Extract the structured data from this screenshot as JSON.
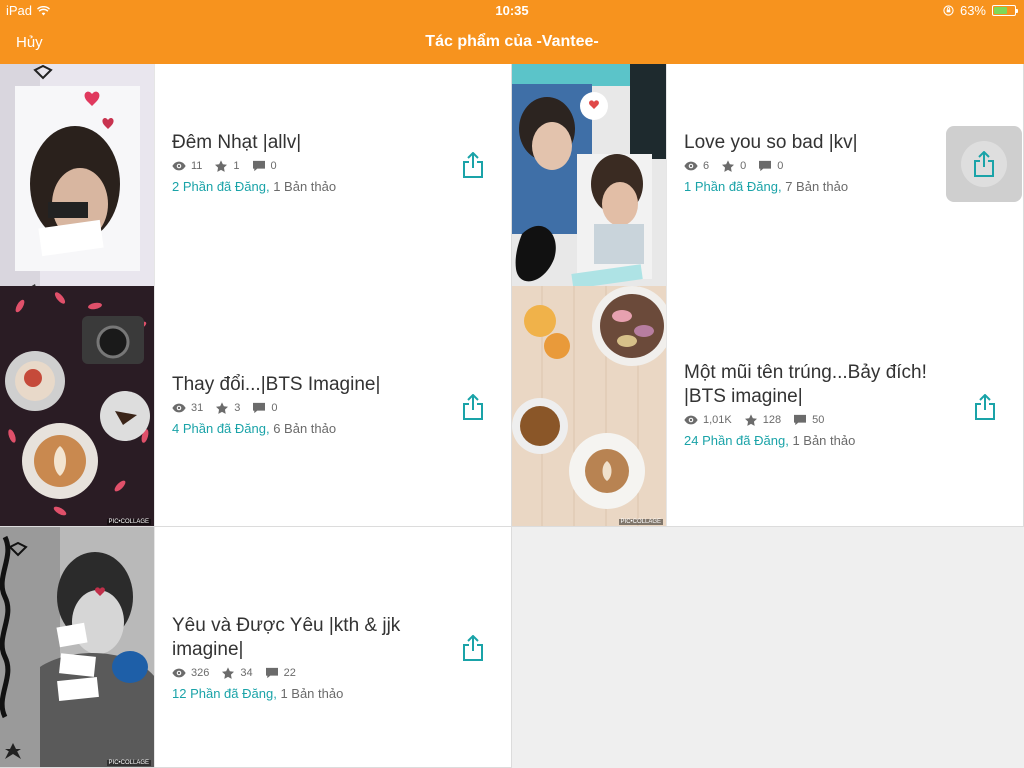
{
  "status": {
    "device": "iPad",
    "time": "10:35",
    "battery": "63%",
    "battery_level": 0.63
  },
  "nav": {
    "cancel": "Hủy",
    "title": "Tác phẩm của -Vantee-"
  },
  "colors": {
    "accent": "#f7931e",
    "link": "#1aa3a8",
    "battery": "#7ed957"
  },
  "icons": {
    "views": "eye-icon",
    "votes": "star-icon",
    "comments": "comment-icon",
    "share": "share-icon"
  },
  "cover_watermark": "PIC•COLLAGE",
  "stories": [
    {
      "title": "Đêm Nhạt |allv|",
      "views": "11",
      "votes": "1",
      "comments": "0",
      "published": "2 Phần đã Đăng,",
      "drafts": "1 Bản thảo"
    },
    {
      "title": "Love you so bad |kv|",
      "views": "6",
      "votes": "0",
      "comments": "0",
      "published": "1 Phần đã Đăng,",
      "drafts": "7 Bản thảo"
    },
    {
      "title": "Thay đổi...|BTS Imagine|",
      "views": "31",
      "votes": "3",
      "comments": "0",
      "published": "4 Phần đã Đăng,",
      "drafts": "6 Bản thảo"
    },
    {
      "title": "Một mũi tên trúng...Bảy đích! |BTS imagine|",
      "views": "1,01K",
      "votes": "128",
      "comments": "50",
      "published": "24 Phần đã Đăng,",
      "drafts": "1 Bản thảo"
    },
    {
      "title": "Yêu và Được Yêu |kth & jjk imagine|",
      "views": "326",
      "votes": "34",
      "comments": "22",
      "published": "12 Phần đã Đăng,",
      "drafts": "1 Bản thảo"
    }
  ]
}
